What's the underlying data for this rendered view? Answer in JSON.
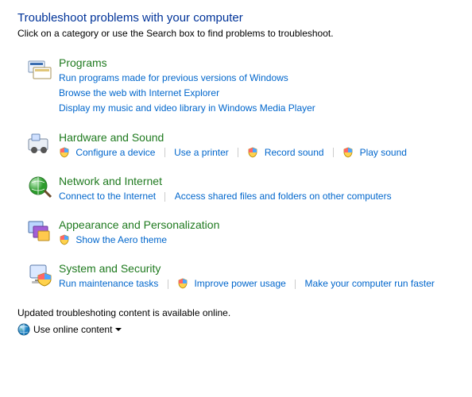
{
  "title": "Troubleshoot problems with your computer",
  "subtitle": "Click on a category or use the Search box to find problems to troubleshoot.",
  "categories": [
    {
      "title": "Programs",
      "links": [
        {
          "label": "Run programs made for previous versions of Windows",
          "shield": false,
          "break": true
        },
        {
          "label": "Browse the web with Internet Explorer",
          "shield": false,
          "break": true
        },
        {
          "label": "Display my music and video library in Windows Media Player",
          "shield": false,
          "break": true
        }
      ]
    },
    {
      "title": "Hardware and Sound",
      "links": [
        {
          "label": "Configure a device",
          "shield": true,
          "break": false
        },
        {
          "label": "Use a printer",
          "shield": false,
          "break": false
        },
        {
          "label": "Record sound",
          "shield": true,
          "break": false
        },
        {
          "label": "Play sound",
          "shield": true,
          "break": false
        }
      ]
    },
    {
      "title": "Network and Internet",
      "links": [
        {
          "label": "Connect to the Internet",
          "shield": false,
          "break": false
        },
        {
          "label": "Access shared files and folders on other computers",
          "shield": false,
          "break": false
        }
      ]
    },
    {
      "title": "Appearance and Personalization",
      "links": [
        {
          "label": "Show the Aero theme",
          "shield": true,
          "break": false
        }
      ]
    },
    {
      "title": "System and Security",
      "links": [
        {
          "label": "Run maintenance tasks",
          "shield": false,
          "break": false
        },
        {
          "label": "Improve power usage",
          "shield": true,
          "break": false
        },
        {
          "label": "Make your computer run faster",
          "shield": false,
          "break": false
        }
      ]
    }
  ],
  "footer": {
    "status": "Updated troubleshoting content is available online.",
    "dropdown_label": "Use online content"
  }
}
